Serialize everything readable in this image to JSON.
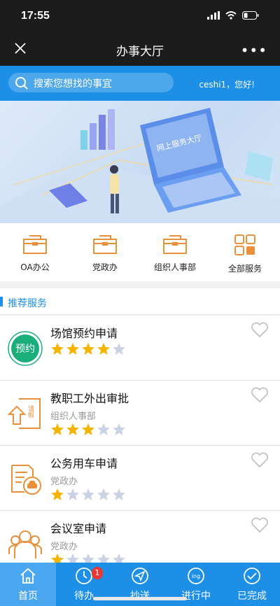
{
  "status": {
    "time": "17:55"
  },
  "nav": {
    "title": "办事大厅",
    "more": "•••"
  },
  "search": {
    "placeholder": "搜索您想找的事宜",
    "greeting": "ceshi1，您好!"
  },
  "banner": {
    "screen_text": "网上服务大厅"
  },
  "quick": [
    {
      "label": "OA办公",
      "icon": "folder-icon"
    },
    {
      "label": "党政办",
      "icon": "folder-icon"
    },
    {
      "label": "组织人事部",
      "icon": "folder-icon"
    },
    {
      "label": "全部服务",
      "icon": "grid-icon"
    }
  ],
  "section": {
    "title": "推荐服务"
  },
  "services": [
    {
      "name": "场馆预约申请",
      "dept": "",
      "rating": 4,
      "icon": "booking-badge-icon",
      "icon_text": "预约"
    },
    {
      "name": "教职工外出审批",
      "dept": "组织人事部",
      "rating": 3,
      "icon": "leave-form-icon",
      "icon_text": "请假"
    },
    {
      "name": "公务用车申请",
      "dept": "党政办",
      "rating": 1,
      "icon": "vehicle-request-icon"
    },
    {
      "name": "会议室申请",
      "dept": "党政办",
      "rating": 1,
      "icon": "meeting-people-icon"
    }
  ],
  "tabs": [
    {
      "label": "首页",
      "icon": "home-icon",
      "active": true
    },
    {
      "label": "待办",
      "icon": "clock-icon",
      "badge": "1"
    },
    {
      "label": "抄送",
      "icon": "send-icon"
    },
    {
      "label": "进行中",
      "icon": "ing-icon",
      "icon_text": "ing"
    },
    {
      "label": "已完成",
      "icon": "check-icon"
    }
  ],
  "colors": {
    "primary": "#1e8fe6",
    "accent": "#e8913a",
    "star": "#f5b400",
    "star_empty": "#c9d3e3",
    "green": "#1aaf7a"
  }
}
